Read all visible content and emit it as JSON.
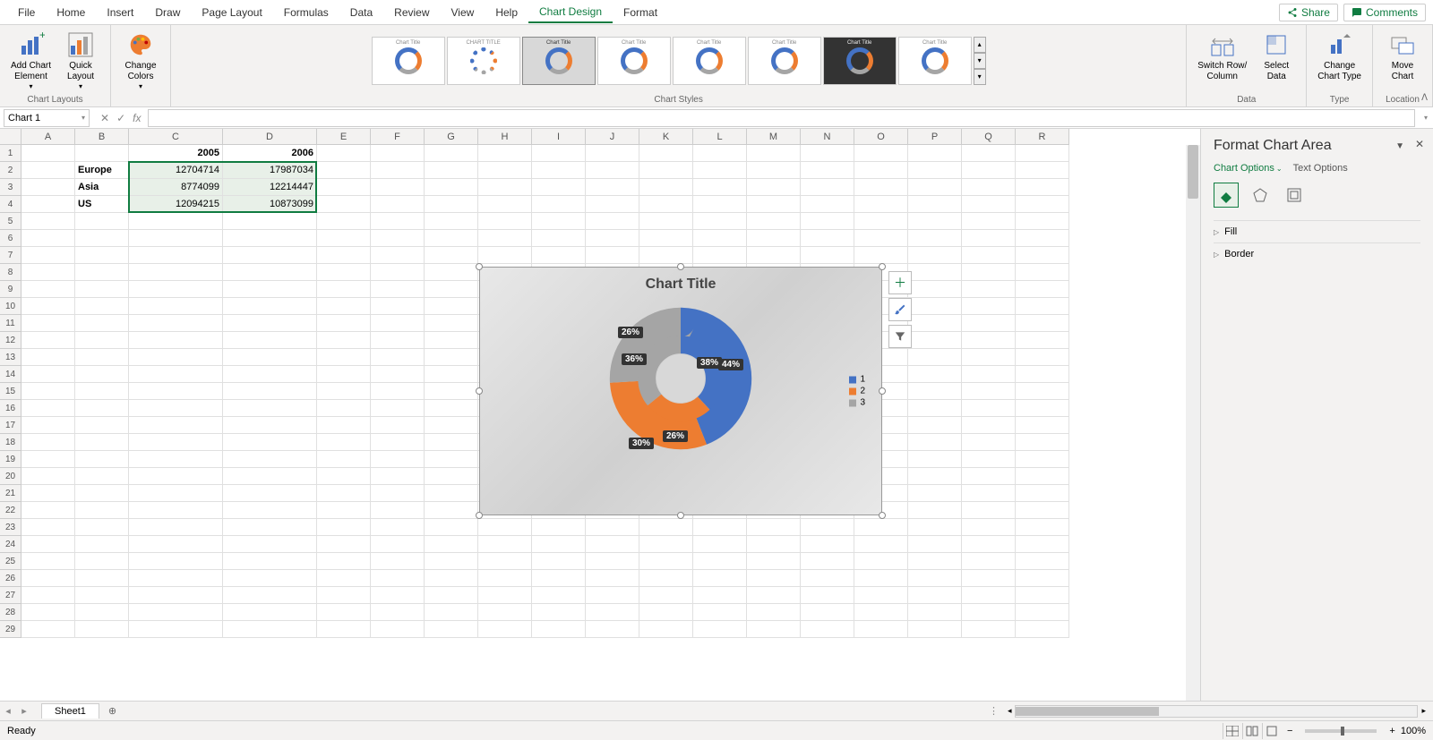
{
  "menus": [
    "File",
    "Home",
    "Insert",
    "Draw",
    "Page Layout",
    "Formulas",
    "Data",
    "Review",
    "View",
    "Help",
    "Chart Design",
    "Format"
  ],
  "active_menu": "Chart Design",
  "share_label": "Share",
  "comments_label": "Comments",
  "ribbon": {
    "chart_layouts": {
      "add_chart_element": "Add Chart\nElement",
      "quick_layout": "Quick\nLayout",
      "label": "Chart Layouts"
    },
    "change_colors": {
      "label": "Change\nColors"
    },
    "chart_styles_label": "Chart Styles",
    "data_group": {
      "switch": "Switch Row/\nColumn",
      "select": "Select\nData",
      "label": "Data"
    },
    "type_group": {
      "change": "Change\nChart Type",
      "label": "Type"
    },
    "location_group": {
      "move": "Move\nChart",
      "label": "Location"
    }
  },
  "name_box": "Chart 1",
  "columns": [
    "A",
    "B",
    "C",
    "D",
    "E",
    "F",
    "G",
    "H",
    "I",
    "J",
    "K",
    "L",
    "M",
    "N",
    "O",
    "P",
    "Q",
    "R"
  ],
  "table": {
    "headers": {
      "c": "2005",
      "d": "2006"
    },
    "rows": [
      {
        "b": "Europe",
        "c": "12704714",
        "d": "17987034"
      },
      {
        "b": "Asia",
        "c": "8774099",
        "d": "12214447"
      },
      {
        "b": "US",
        "c": "12094215",
        "d": "10873099"
      }
    ]
  },
  "chart": {
    "title": "Chart Title",
    "legend": [
      "1",
      "2",
      "3"
    ],
    "labels": {
      "inner_38": "38%",
      "inner_26a": "26%",
      "inner_36": "36%",
      "outer_44": "44%",
      "outer_26": "26%",
      "outer_30": "30%"
    }
  },
  "chart_data": {
    "type": "pie",
    "title": "Chart Title",
    "series": [
      {
        "name": "2005",
        "categories": [
          "Europe",
          "Asia",
          "US"
        ],
        "values": [
          38,
          26,
          36
        ],
        "unit": "percent"
      },
      {
        "name": "2006",
        "categories": [
          "Europe",
          "Asia",
          "US"
        ],
        "values": [
          44,
          30,
          26
        ],
        "unit": "percent"
      }
    ],
    "legend_labels": [
      "1",
      "2",
      "3"
    ],
    "colors": {
      "1": "#4472c4",
      "2": "#ed7d31",
      "3": "#a5a5a5"
    }
  },
  "format_pane": {
    "title": "Format Chart Area",
    "tab_options": "Chart Options",
    "tab_text": "Text Options",
    "sections": [
      "Fill",
      "Border"
    ]
  },
  "sheet_tab": "Sheet1",
  "status": "Ready",
  "zoom": "100%"
}
